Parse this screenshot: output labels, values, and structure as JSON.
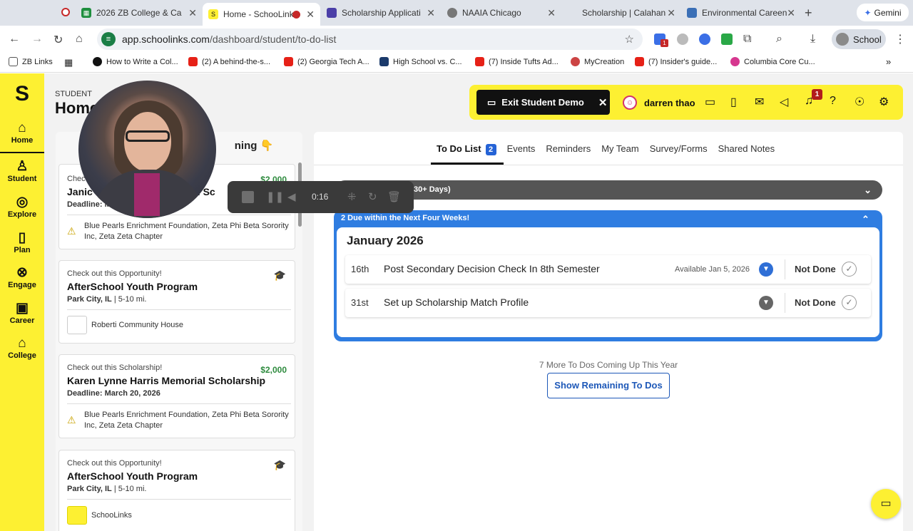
{
  "browser": {
    "tabs": [
      {
        "label": "2026 ZB College & Ca",
        "icon": "sheets-icon"
      },
      {
        "label": "Home - SchooLinks",
        "icon": "schoolinks-icon",
        "active": true
      },
      {
        "label": "Scholarship Applicati",
        "icon": "doc-icon"
      },
      {
        "label": "NAAIA Chicago",
        "icon": "globe-icon"
      },
      {
        "label": "Scholarship | Calahan",
        "icon": "page-icon"
      },
      {
        "label": "Environmental Careen",
        "icon": "page-icon"
      }
    ],
    "gemini_label": "Gemini",
    "url_host": "app.schoolinks.com",
    "url_path": "/dashboard/student/to-do-list",
    "profile_label": "School",
    "extension_badge": "1",
    "bookmarks": [
      "ZB Links",
      "How to Write a Col...",
      "(2) A behind-the-s...",
      "(2) Georgia Tech A...",
      "High School vs. C...",
      "(7) Inside Tufts Ad...",
      "MyCreation",
      "(7) Insider's guide...",
      "Columbia Core Cu..."
    ]
  },
  "sidebar": {
    "items": [
      {
        "label": "Home",
        "icon": "home-icon",
        "active": true
      },
      {
        "label": "Student",
        "icon": "student-icon"
      },
      {
        "label": "Explore",
        "icon": "compass-icon"
      },
      {
        "label": "Plan",
        "icon": "book-icon"
      },
      {
        "label": "Engage",
        "icon": "handshake-icon"
      },
      {
        "label": "Career",
        "icon": "briefcase-icon"
      },
      {
        "label": "College",
        "icon": "college-icon"
      }
    ]
  },
  "page": {
    "label": "STUDENT",
    "title": "Home"
  },
  "topbar": {
    "exit_demo_label": "Exit Student Demo",
    "user_name": "darren thao",
    "notification_count": "1"
  },
  "left_panel": {
    "header": "ning 👇",
    "cards": [
      {
        "type": "Chec",
        "name": "Janic",
        "name_tail": "al Sc",
        "amount": "$2,000",
        "deadline": "Deadline: M",
        "org": "Blue Pearls Enrichment Foundation, Zeta Phi Beta Sorority Inc, Zeta Zeta Chapter"
      },
      {
        "type": "Check out this Opportunity!",
        "name": "AfterSchool Youth Program",
        "location": "Park City, IL",
        "distance": " | 5-10 mi.",
        "org": "Roberti Community House"
      },
      {
        "type": "Check out this Scholarship!",
        "name": "Karen Lynne Harris Memorial Scholarship",
        "amount": "$2,000",
        "deadline": "Deadline: March 20, 2026",
        "org": "Blue Pearls Enrichment Foundation, Zeta Phi Beta Sorority Inc, Zeta Zeta Chapter"
      },
      {
        "type": "Check out this Opportunity!",
        "name": "AfterSchool Youth Program",
        "location": "Park City, IL",
        "distance": " | 5-10 mi.",
        "org": "SchooLinks"
      }
    ]
  },
  "main": {
    "tabs": [
      {
        "label": "To Do List",
        "count": "2",
        "active": true
      },
      {
        "label": "Events"
      },
      {
        "label": "Reminders"
      },
      {
        "label": "My Team"
      },
      {
        "label": "Survey/Forms"
      },
      {
        "label": "Shared Notes"
      }
    ],
    "overdue_label": "30+ Days)",
    "due_label": "2 Due within the Next Four Weeks!",
    "month": "January 2026",
    "todos": [
      {
        "day": "16th",
        "name": "Post Secondary Decision Check In 8th Semester",
        "available": "Available Jan 5, 2026",
        "status": "Not Done",
        "expand_color": "#2f6fd6"
      },
      {
        "day": "31st",
        "name": "Set up Scholarship Match Profile",
        "available": "",
        "status": "Not Done",
        "expand_color": "#666666"
      }
    ],
    "more_text": "7 More To Dos Coming Up This Year",
    "show_remaining_label": "Show Remaining To Dos"
  },
  "recorder": {
    "time": "0:16"
  },
  "colors": {
    "brand_yellow": "#fdf032",
    "accent_blue": "#2f7de1",
    "scholarship_green": "#2e8b3e"
  }
}
